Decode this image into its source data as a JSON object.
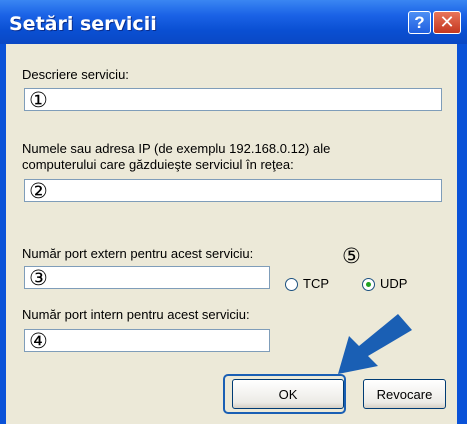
{
  "window": {
    "title": "Setări servicii",
    "help_label": "?",
    "close_label": "✕"
  },
  "form": {
    "description_label": "Descriere serviciu:",
    "description_marker": "①",
    "ip_label_line1": "Numele sau adresa IP (de exemplu 192.168.0.12) ale",
    "ip_label_line2": "computerului care găzduieşte serviciul în reţea:",
    "ip_marker": "②",
    "ext_port_label": "Număr port extern pentru acest serviciu:",
    "ext_port_marker": "③",
    "protocol_marker": "⑤",
    "tcp_label": "TCP",
    "udp_label": "UDP",
    "protocol_selected": "UDP",
    "int_port_label": "Număr port intern pentru acest serviciu:",
    "int_port_marker": "④"
  },
  "buttons": {
    "ok_label": "OK",
    "cancel_label": "Revocare"
  },
  "colors": {
    "title_bar": "#0a52d8",
    "dialog_bg": "#ece9d8",
    "arrow": "#1a5fb4"
  }
}
